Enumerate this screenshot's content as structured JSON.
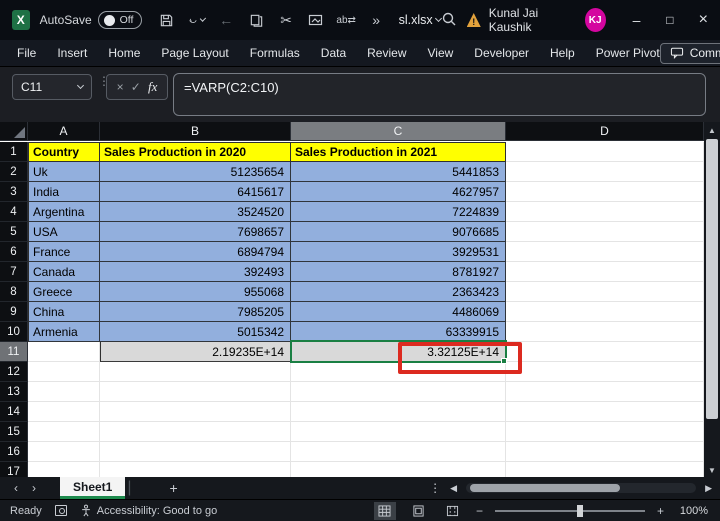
{
  "titlebar": {
    "app_icon_letter": "X",
    "autosave_label": "AutoSave",
    "autosave_state": "Off",
    "filename": "sl.xlsx",
    "account_name": "Kunal Jai Kaushik",
    "account_initials": "KJ",
    "warning_glyph": "!"
  },
  "icons": {
    "back_arrow": "←",
    "scissors": "✂",
    "more_commands": "»",
    "cancel": "×",
    "enter": "✓",
    "fx": "fx",
    "dots_vertical": "⋮",
    "minimize": "–",
    "maximize": "□",
    "close": "×",
    "nav_left": "‹",
    "nav_right": "›",
    "add_sheet": "+",
    "up_arrow": "▲",
    "down_arrow": "▼",
    "left_tri": "◀",
    "right_tri": "▶",
    "zoom_out": "−",
    "zoom_in": "+",
    "replace_ab": "ab⇄"
  },
  "ribbon": {
    "tabs": [
      "File",
      "Insert",
      "Home",
      "Page Layout",
      "Formulas",
      "Data",
      "Review",
      "View",
      "Developer",
      "Help",
      "Power Pivot"
    ],
    "comments_label": "Comments"
  },
  "formula_bar": {
    "name_box": "C11",
    "formula": "=VARP(C2:C10)"
  },
  "sheet": {
    "column_headers": [
      "A",
      "B",
      "C",
      "D"
    ],
    "selected_column": "C",
    "selected_row": 11,
    "selection": {
      "active_cell": "C11"
    },
    "rows": [
      {
        "num": 1,
        "a": "Country",
        "b": "Sales Production in 2020",
        "c": "Sales Production in 2021",
        "d": ""
      },
      {
        "num": 2,
        "a": "Uk",
        "b": "51235654",
        "c": "5441853",
        "d": ""
      },
      {
        "num": 3,
        "a": "India",
        "b": "6415617",
        "c": "4627957",
        "d": ""
      },
      {
        "num": 4,
        "a": "Argentina",
        "b": "3524520",
        "c": "7224839",
        "d": ""
      },
      {
        "num": 5,
        "a": "USA",
        "b": "7698657",
        "c": "9076685",
        "d": ""
      },
      {
        "num": 6,
        "a": "France",
        "b": "6894794",
        "c": "3929531",
        "d": ""
      },
      {
        "num": 7,
        "a": "Canada",
        "b": "392493",
        "c": "8781927",
        "d": ""
      },
      {
        "num": 8,
        "a": "Greece",
        "b": "955068",
        "c": "2363423",
        "d": ""
      },
      {
        "num": 9,
        "a": "China",
        "b": "7985205",
        "c": "4486069",
        "d": ""
      },
      {
        "num": 10,
        "a": "Armenia",
        "b": "5015342",
        "c": "63339915",
        "d": ""
      },
      {
        "num": 11,
        "a": "",
        "b": "2.19235E+14",
        "c": "3.32125E+14",
        "d": ""
      },
      {
        "num": 12,
        "a": "",
        "b": "",
        "c": "",
        "d": ""
      },
      {
        "num": 13,
        "a": "",
        "b": "",
        "c": "",
        "d": ""
      },
      {
        "num": 14,
        "a": "",
        "b": "",
        "c": "",
        "d": ""
      },
      {
        "num": 15,
        "a": "",
        "b": "",
        "c": "",
        "d": ""
      },
      {
        "num": 16,
        "a": "",
        "b": "",
        "c": "",
        "d": ""
      },
      {
        "num": 17,
        "a": "",
        "b": "",
        "c": "",
        "d": ""
      }
    ]
  },
  "sheet_tabs": {
    "active": "Sheet1"
  },
  "status_bar": {
    "mode": "Ready",
    "accessibility": "Accessibility: Good to go",
    "zoom": "100%"
  },
  "colors": {
    "highlight_blue": "#92afdd",
    "header_yellow": "#ffff00",
    "result_gray": "#d9d9d9",
    "selection_green": "#1a7f43",
    "annotation_red": "#dc2a20",
    "share_green": "#2aa05a",
    "avatar_magenta": "#d4069f"
  }
}
